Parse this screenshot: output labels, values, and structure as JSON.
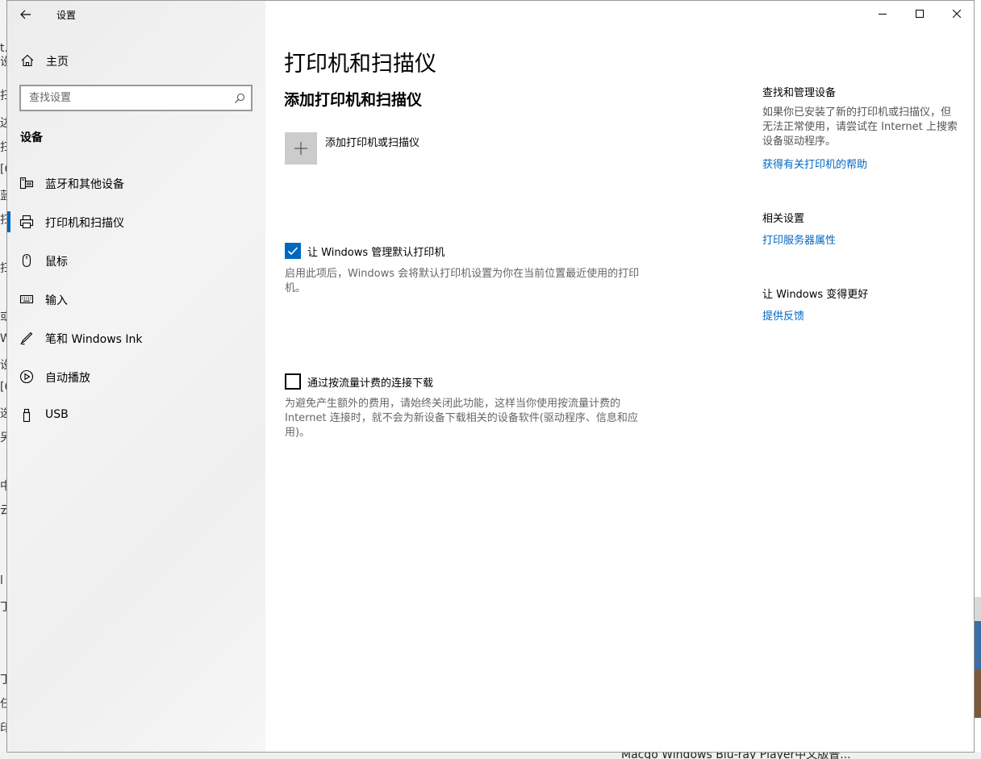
{
  "background": {
    "left_fragments": [
      "t.",
      "设",
      "扫",
      "边",
      "扫",
      "[6",
      "蓝",
      "扫",
      "扫",
      "或",
      "W",
      "设",
      "[6",
      "选",
      "另",
      "中",
      "云",
      "l",
      "丁",
      "丁",
      "任",
      "印"
    ],
    "taskbar_title": "Macgo Windows Blu-ray Player中文版普..."
  },
  "window": {
    "title": "设置",
    "controls": {
      "minimize_icon": "minimize-icon",
      "maximize_icon": "maximize-icon",
      "close_icon": "close-icon"
    }
  },
  "sidebar": {
    "home_label": "主页",
    "search_placeholder": "查找设置",
    "section_title": "设备",
    "items": [
      {
        "label": "蓝牙和其他设备",
        "icon": "bluetooth-devices-icon"
      },
      {
        "label": "打印机和扫描仪",
        "icon": "printer-icon",
        "active": true
      },
      {
        "label": "鼠标",
        "icon": "mouse-icon"
      },
      {
        "label": "输入",
        "icon": "keyboard-icon"
      },
      {
        "label": "笔和 Windows Ink",
        "icon": "pen-icon"
      },
      {
        "label": "自动播放",
        "icon": "autoplay-icon"
      },
      {
        "label": "USB",
        "icon": "usb-icon"
      }
    ]
  },
  "main": {
    "title": "打印机和扫描仪",
    "add_section_title": "添加打印机和扫描仪",
    "add_button_label": "添加打印机或扫描仪",
    "manage_default": {
      "label": "让 Windows 管理默认打印机",
      "checked": true,
      "description": "启用此项后，Windows 会将默认打印机设置为你在当前位置最近使用的打印机。"
    },
    "metered_download": {
      "label": "通过按流量计费的连接下载",
      "checked": false,
      "description": "为避免产生额外的费用，请始终关闭此功能，这样当你使用按流量计费的 Internet 连接时，就不会为新设备下载相关的设备软件(驱动程序、信息和应用)。"
    }
  },
  "right_panel": {
    "find_manage": {
      "title": "查找和管理设备",
      "text": "如果你已安装了新的打印机或扫描仪，但无法正常使用，请尝试在 Internet 上搜索设备驱动程序。",
      "link": "获得有关打印机的帮助"
    },
    "related": {
      "title": "相关设置",
      "link": "打印服务器属性"
    },
    "better": {
      "title": "让 Windows 变得更好",
      "link": "提供反馈"
    }
  },
  "colors": {
    "accent": "#0067c0",
    "sidebar_bg": "#efefef",
    "tile_bg": "#cccccc"
  }
}
